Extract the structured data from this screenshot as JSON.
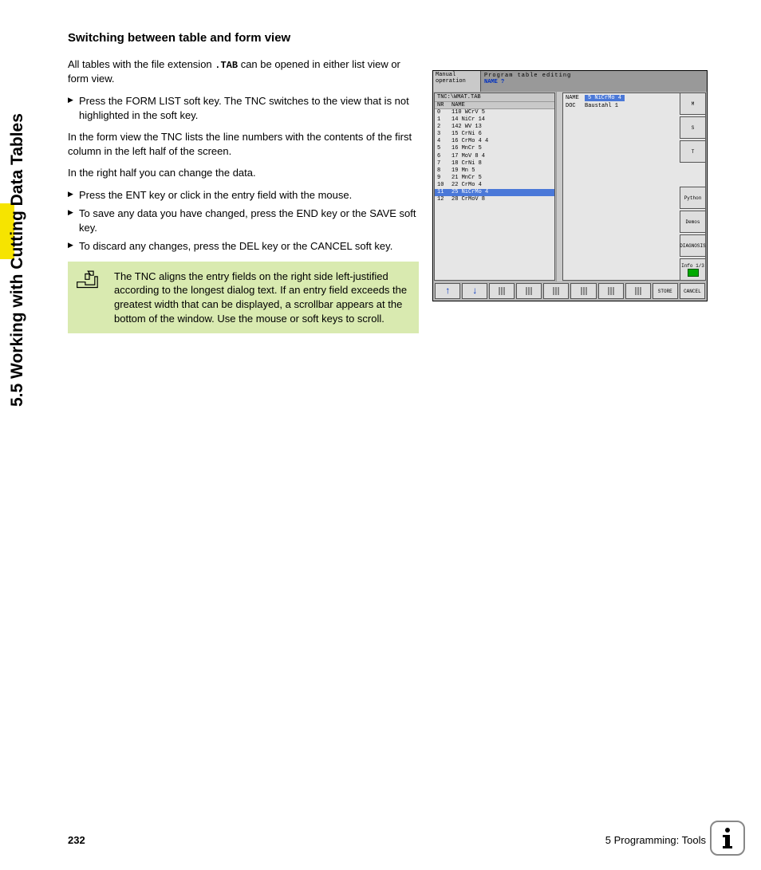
{
  "side_tab": "5.5 Working with Cutting Data Tables",
  "heading": "Switching between table and form view",
  "para1a": "All tables with the file extension ",
  "para1_ext": ".TAB",
  "para1b": " can be opened in either list view or form view.",
  "bullet1": "Press the FORM LIST soft key. The TNC switches to the view that is not highlighted in the soft key.",
  "para2": "In the form view the TNC lists the line numbers with the contents of the first column in the left half of the screen.",
  "para3": "In the right half you can change the data.",
  "bullet2": "Press the ENT key or click in the entry field with the mouse.",
  "bullet3": "To save any data you have changed, press the END key or the SAVE soft key.",
  "bullet4": "To discard any changes, press the DEL key or the CANCEL soft key.",
  "note": "The TNC aligns the entry fields on the right side left-justified according to the longest dialog text. If an entry field exceeds the greatest width that can be displayed, a scrollbar appears at the bottom of the window. Use the mouse or soft keys to scroll.",
  "screenshot": {
    "header_left_l1": "Manual",
    "header_left_l2": "operation",
    "header_right_l1": "Program table editing",
    "header_right_l2": "NAME ?",
    "left_title": "TNC:\\WMAT.TAB",
    "col_nr": "NR",
    "col_name": "NAME",
    "rows": [
      {
        "nr": "0",
        "name": "110 WCrV 5"
      },
      {
        "nr": "1",
        "name": "14 NiCr 14"
      },
      {
        "nr": "2",
        "name": "142 WV 13"
      },
      {
        "nr": "3",
        "name": "15 CrNi 6"
      },
      {
        "nr": "4",
        "name": "16 CrMo 4 4"
      },
      {
        "nr": "5",
        "name": "16 MnCr 5"
      },
      {
        "nr": "6",
        "name": "17 MoV 8 4"
      },
      {
        "nr": "7",
        "name": "18 CrNi 8"
      },
      {
        "nr": "8",
        "name": "19 Mn 5"
      },
      {
        "nr": "9",
        "name": "21 MnCr 5"
      },
      {
        "nr": "10",
        "name": "22 CrMo 4"
      },
      {
        "nr": "11",
        "name": "25 NiCrMo 4",
        "selected": true
      },
      {
        "nr": "12",
        "name": "28 CrMoV 8"
      }
    ],
    "right_name_lbl": "NAME",
    "right_name_val": "5 NiCrMo 4",
    "right_doc_lbl": "DOC",
    "right_doc_val": "Baustahl 1",
    "sidebar": [
      "M",
      "S",
      "T",
      "Python",
      "Demos",
      "DIAGNOSIS",
      "Info 1/3"
    ],
    "softkeys": {
      "store": "STORE",
      "cancel": "CANCEL"
    }
  },
  "footer": {
    "page": "232",
    "chapter": "5 Programming: Tools"
  }
}
